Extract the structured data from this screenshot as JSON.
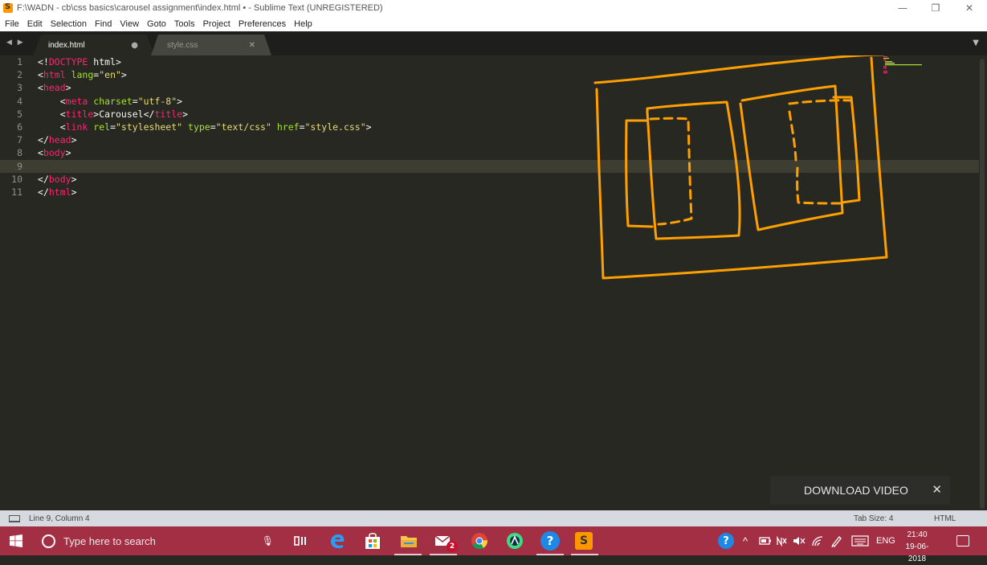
{
  "window": {
    "title": "F:\\WADN - cb\\css basics\\carousel assignment\\index.html • - Sublime Text (UNREGISTERED)",
    "controls": {
      "minimize": "—",
      "maximize": "❐",
      "close": "✕"
    }
  },
  "menubar": [
    "File",
    "Edit",
    "Selection",
    "Find",
    "View",
    "Goto",
    "Tools",
    "Project",
    "Preferences",
    "Help"
  ],
  "tabs": [
    {
      "label": "index.html",
      "state": "modified",
      "marker": "●"
    },
    {
      "label": "style.css",
      "state": "saved",
      "marker": "✕"
    }
  ],
  "tab_nav": {
    "arrows": "◀ ▶",
    "overflow": "▼"
  },
  "editor": {
    "current_line": 9,
    "line_numbers": [
      "1",
      "2",
      "3",
      "4",
      "5",
      "6",
      "7",
      "8",
      "9",
      "10",
      "11"
    ],
    "lines": [
      "<!DOCTYPE html>",
      "<html lang=\"en\">",
      "<head>",
      "    <meta charset=\"utf-8\">",
      "    <title>Carousel</title>",
      "    <link rel=\"stylesheet\" type=\"text/css\" href=\"style.css\">",
      "</head>",
      "<body>",
      "",
      "</body>",
      "</html>"
    ]
  },
  "colors": {
    "editor_bg": "#272822",
    "tag": "#f92672",
    "attribute": "#a6e22e",
    "string": "#e6db74",
    "drawing": "#ffa000",
    "taskbar": "#a22f44"
  },
  "overlay": {
    "download_label": "DOWNLOAD VIDEO",
    "close": "✕"
  },
  "statusbar": {
    "position": "Line 9, Column 4",
    "tab_size": "Tab Size: 4",
    "syntax": "HTML"
  },
  "taskbar": {
    "search_placeholder": "Type here to search",
    "mail_badge": "2",
    "help_icon": "?",
    "sublime_icon": "S",
    "tray": {
      "chevron": "^",
      "language": "ENG"
    },
    "time": "21:40",
    "date": "19-06-2018"
  }
}
